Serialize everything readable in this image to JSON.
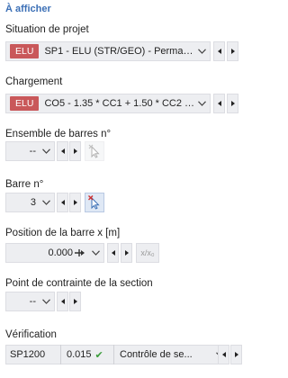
{
  "panel": {
    "title": "À afficher"
  },
  "design_situation": {
    "label": "Situation de projet",
    "badge": "ELU",
    "value": "SP1 - ELU (STR/GEO) - Permane..."
  },
  "loading": {
    "label": "Chargement",
    "badge": "ELU",
    "value": "CO5 - 1.35 * CC1 + 1.50 * CC2 +..."
  },
  "member_set": {
    "label": "Ensemble de barres n°",
    "value": "--"
  },
  "member": {
    "label": "Barre n°",
    "value": "3"
  },
  "member_position": {
    "label": "Position de la barre x [m]",
    "value": "0.000",
    "relative_button": "x/x₀"
  },
  "stress_point": {
    "label": "Point de contrainte de la section",
    "value": "--"
  },
  "verification": {
    "label": "Vérification",
    "code": "SP1200",
    "ratio": "0.015",
    "type": "Contrôle de se..."
  },
  "colors": {
    "accent": "#3b6fb6",
    "badge": "#c9585a",
    "ok": "#3a9d3a",
    "pick_x": "#d03030"
  }
}
